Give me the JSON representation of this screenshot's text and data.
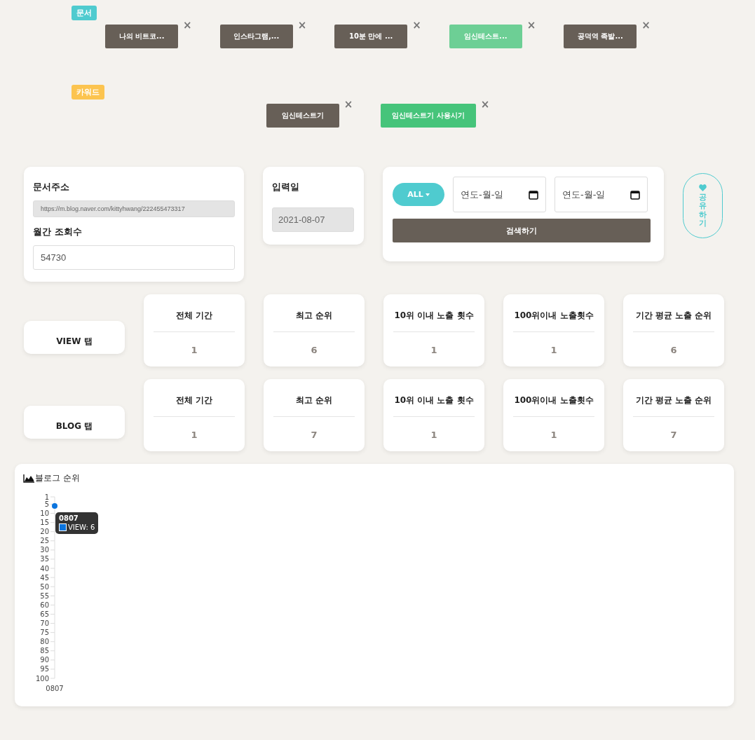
{
  "document_section": {
    "badge": "문서",
    "chips": [
      {
        "label": "나의 비트코...",
        "selected": false,
        "close": "×"
      },
      {
        "label": "인스타그램,...",
        "selected": false,
        "close": "×"
      },
      {
        "label": "10분 만에 ...",
        "selected": false,
        "close": "×"
      },
      {
        "label": "임신테스트...",
        "selected": true,
        "close": "×"
      },
      {
        "label": "공덕역 족발...",
        "selected": false,
        "close": "×"
      }
    ]
  },
  "keyword_section": {
    "badge": "카워드",
    "chips": [
      {
        "label": "임신테스트기",
        "selected": false,
        "close": "×"
      },
      {
        "label": "임신테스트기 사용시기",
        "selected": true,
        "close": "×"
      }
    ]
  },
  "info_card": {
    "url_label": "문서주소",
    "url_value": "https://m.blog.naver.com/kittyhwang/222455473317",
    "views_label": "월간 조회수",
    "views_value": "54730"
  },
  "date_card": {
    "label": "입력일",
    "value": "2021-08-07"
  },
  "filter_card": {
    "dropdown": "ALL",
    "start_date": {
      "placeholder": "연도-월-일"
    },
    "end_date": {
      "placeholder": "연도-월-일"
    },
    "search_button": "검색하기"
  },
  "share_button": "공유하기",
  "stat_rows": [
    {
      "tab": "VIEW 탭",
      "stats": [
        {
          "label": "전체 기간",
          "value": "1"
        },
        {
          "label": "최고 순위",
          "value": "6"
        },
        {
          "label": "10위 이내 노출 횟수",
          "value": "1"
        },
        {
          "label": "100위이내 노출횟수",
          "value": "1"
        },
        {
          "label": "기간 평균 노출 순위",
          "value": "6"
        }
      ]
    },
    {
      "tab": "BLOG 탭",
      "stats": [
        {
          "label": "전체 기간",
          "value": "1"
        },
        {
          "label": "최고 순위",
          "value": "7"
        },
        {
          "label": "10위 이내 노출 횟수",
          "value": "1"
        },
        {
          "label": "100위이내 노출횟수",
          "value": "1"
        },
        {
          "label": "기간 평균 노출 순위",
          "value": "7"
        }
      ]
    }
  ],
  "chart_panel": {
    "title": "블로그 순위",
    "tooltip": {
      "title": "0807",
      "text": "VIEW: 6"
    },
    "chart_data": {
      "type": "line",
      "categories": [
        "0807"
      ],
      "series": [
        {
          "color": "#0b74de",
          "marker": true,
          "values": [
            6
          ]
        }
      ],
      "ylim": [
        100,
        1
      ],
      "yticks": [
        1,
        5,
        10,
        15,
        20,
        25,
        30,
        35,
        40,
        45,
        50,
        55,
        60,
        65,
        70,
        75,
        80,
        85,
        90,
        95,
        100
      ]
    }
  }
}
